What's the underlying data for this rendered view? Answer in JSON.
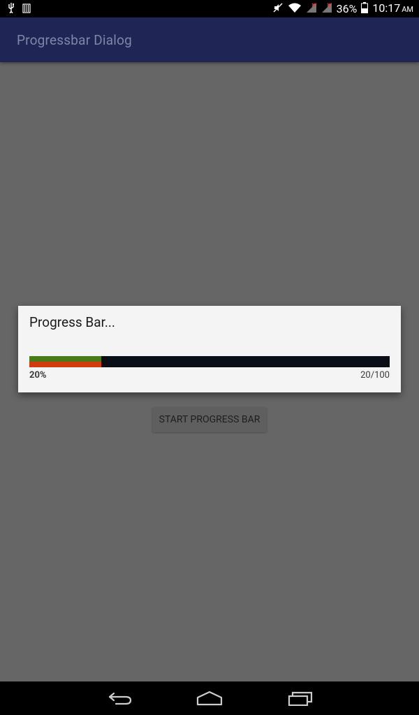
{
  "status_bar": {
    "icons_left": [
      "usb-icon",
      "sd-card-icon"
    ],
    "icons_right": [
      "mute-icon",
      "wifi-icon",
      "signal-icon",
      "signal-icon"
    ],
    "battery_percent": "36%",
    "time": "10:17",
    "ampm": "AM"
  },
  "app": {
    "title": "Progressbar Dialog"
  },
  "dialog": {
    "title": "Progress Bar...",
    "progress": {
      "value": 20,
      "max": 100,
      "percent_label": "20%",
      "count_label": "20/100",
      "colors": {
        "track": "#0a0e16",
        "fill_top": "#4a7b18",
        "fill_bottom": "#d23a10"
      }
    }
  },
  "main": {
    "start_button_label": "START PROGRESS BAR"
  },
  "nav": {
    "icons": [
      "back-icon",
      "home-icon",
      "recents-icon"
    ]
  },
  "colors": {
    "action_bar": "#1f2656",
    "background_dimmed": "#666666"
  }
}
